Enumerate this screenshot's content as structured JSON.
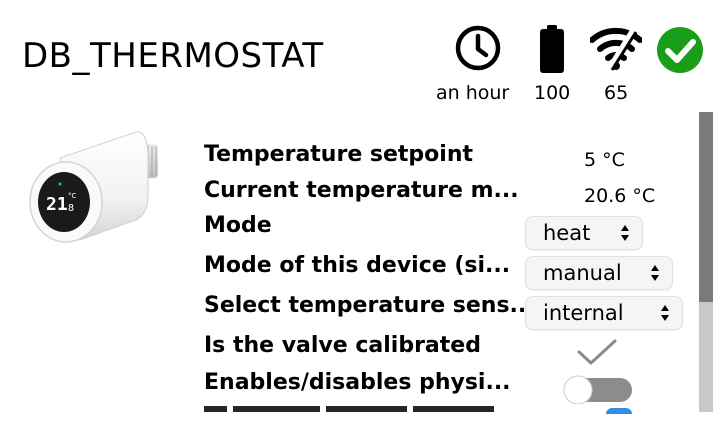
{
  "header": {
    "title": "DB_THERMOSTAT",
    "last_seen": "an hour",
    "battery": "100",
    "link_quality": "65",
    "status_color": "#1a9e1a"
  },
  "rows": [
    {
      "label": "Temperature setpoint",
      "value": "5 °C"
    },
    {
      "label": "Current temperature m...",
      "value": "20.6 °C"
    },
    {
      "label": "Mode",
      "select": "heat"
    },
    {
      "label": "Mode of this device (si...",
      "select": "manual"
    },
    {
      "label": "Select temperature sens...",
      "select": "internal"
    },
    {
      "label": "Is the valve calibrated",
      "checked": true
    },
    {
      "label": "Enables/disables physi...",
      "toggle_on": false
    }
  ],
  "device_display": {
    "digits": "21",
    "unit": "°C",
    "decimal": "8"
  },
  "icons": {
    "last_seen": "clock-icon",
    "battery": "battery-icon",
    "link_quality": "signal-icon",
    "status": "check-circle-icon",
    "calibrated": "checkmark-icon"
  }
}
